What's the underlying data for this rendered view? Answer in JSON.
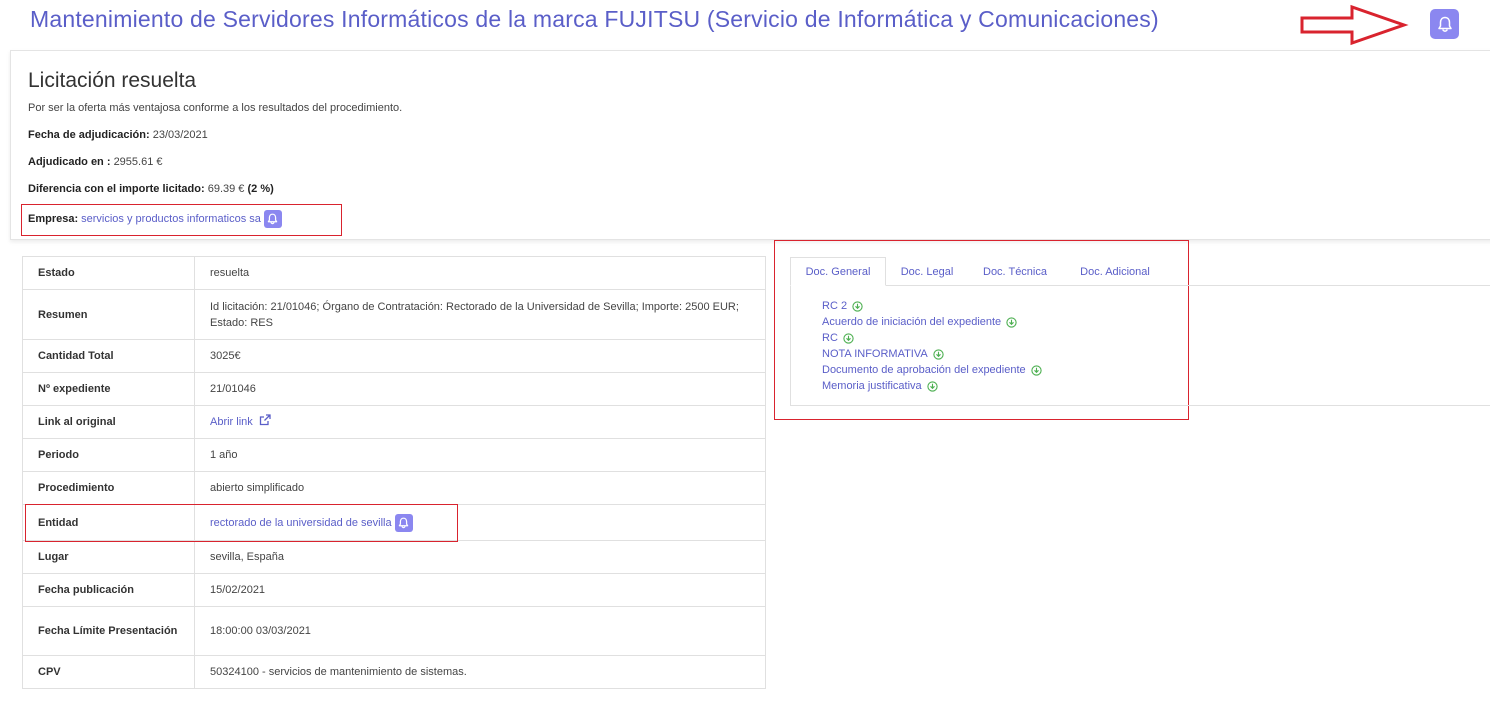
{
  "header": {
    "title": "Mantenimiento de Servidores Informáticos de la marca FUJITSU (Servicio de Informática y Comunicaciones)",
    "bell_icon": "bell-icon",
    "annotation_arrow_color": "#d9232e"
  },
  "award": {
    "title": "Licitación resuelta",
    "description": "Por ser la oferta más ventajosa conforme a los resultados del procedimiento.",
    "date_label": "Fecha de adjudicación:",
    "date_value": "23/03/2021",
    "amount_label": "Adjudicado en :",
    "amount_value": "2955.61 €",
    "diff_label": "Diferencia con el importe licitado:",
    "diff_value": "69.39 €",
    "diff_percent": "(2 %)",
    "company_label": "Empresa:",
    "company_value": "servicios y productos informaticos sa"
  },
  "details": {
    "rows": [
      {
        "label": "Estado",
        "value": "resuelta"
      },
      {
        "label": "Resumen",
        "value": "Id licitación: 21/01046; Órgano de Contratación: Rectorado de la Universidad de Sevilla; Importe: 2500 EUR; Estado: RES"
      },
      {
        "label": "Cantidad Total",
        "value": "3025€"
      },
      {
        "label": "Nº expediente",
        "value": "21/01046"
      },
      {
        "label": "Link al original",
        "value": "Abrir link"
      },
      {
        "label": "Periodo",
        "value": "1 año"
      },
      {
        "label": "Procedimiento",
        "value": "abierto simplificado"
      },
      {
        "label": "Entidad",
        "value": "rectorado de la universidad de sevilla"
      },
      {
        "label": "Lugar",
        "value": "sevilla, España"
      },
      {
        "label": "Fecha publicación",
        "value": "15/02/2021"
      },
      {
        "label": "Fecha Límite Presentación",
        "value": "18:00:00 03/03/2021"
      },
      {
        "label": "CPV",
        "value": "50324100 - servicios de mantenimiento de sistemas."
      }
    ]
  },
  "docs": {
    "tabs": [
      "Doc. General",
      "Doc. Legal",
      "Doc. Técnica",
      "Doc. Adicional"
    ],
    "active_tab": "Doc. General",
    "items": [
      "RC 2",
      "Acuerdo de iniciación del expediente",
      "RC",
      "NOTA INFORMATIVA",
      "Documento de aprobación del expediente",
      "Memoria justificativa"
    ]
  },
  "colors": {
    "accent": "#5a5ec8",
    "bell_bg": "#8b87f0",
    "download_icon": "#4caf50",
    "highlight_border": "#d9232e"
  }
}
